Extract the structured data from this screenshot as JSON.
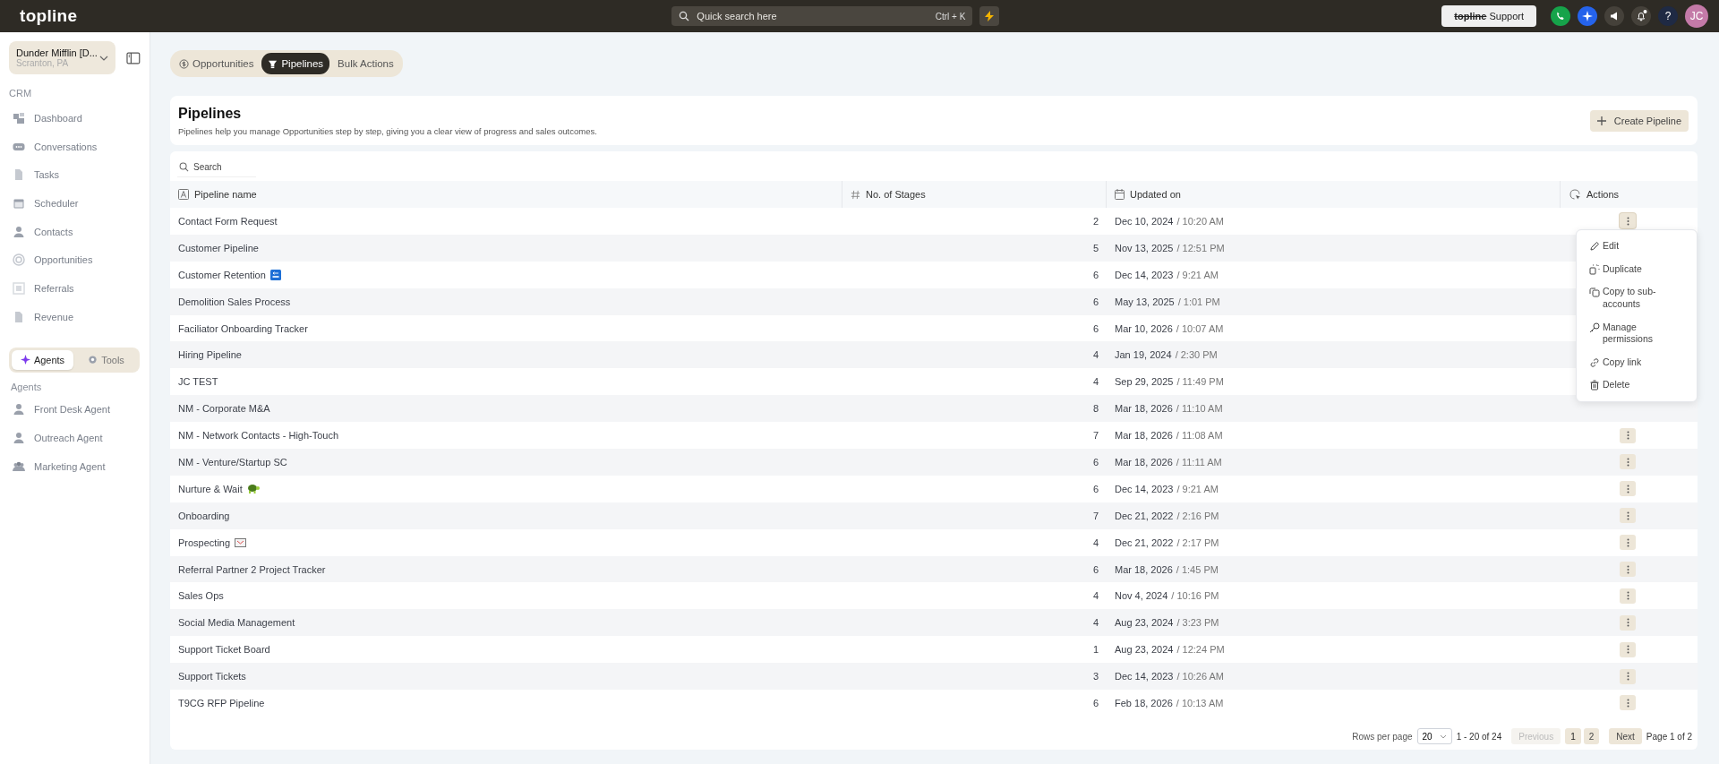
{
  "topbar": {
    "logo": "topline",
    "search": {
      "placeholder": "Quick search here",
      "shortcut": "Ctrl + K"
    },
    "support": {
      "brand": "topline",
      "label": "Support"
    },
    "avatar": "JC",
    "help": "?",
    "notification_dot": true
  },
  "sidebar": {
    "account": {
      "name": "Dunder Mifflin [D...",
      "location": "Scranton, PA"
    },
    "section": "CRM",
    "items": [
      {
        "label": "Dashboard"
      },
      {
        "label": "Conversations"
      },
      {
        "label": "Tasks"
      },
      {
        "label": "Scheduler"
      },
      {
        "label": "Contacts"
      },
      {
        "label": "Opportunities"
      },
      {
        "label": "Referrals"
      },
      {
        "label": "Revenue"
      }
    ],
    "switch": [
      {
        "label": "Agents",
        "selected": true
      },
      {
        "label": "Tools",
        "selected": false
      }
    ],
    "agents_heading": "Agents",
    "agents": [
      {
        "label": "Front Desk Agent"
      },
      {
        "label": "Outreach Agent"
      },
      {
        "label": "Marketing Agent"
      }
    ]
  },
  "tabs": [
    {
      "label": "Opportunities",
      "selected": false
    },
    {
      "label": "Pipelines",
      "selected": true
    },
    {
      "label": "Bulk Actions",
      "selected": false
    }
  ],
  "header": {
    "title": "Pipelines",
    "description": "Pipelines help you manage Opportunities step by step, giving you a clear view of progress and sales outcomes.",
    "button": "Create Pipeline"
  },
  "table": {
    "search_placeholder": "Search",
    "columns": [
      "Pipeline name",
      "No. of Stages",
      "Updated on",
      "Actions"
    ],
    "rows": [
      {
        "name": "Contact Form Request",
        "stages": "2",
        "date": "Dec 10, 2024",
        "time": "/ 10:20 AM",
        "actions_shown": true,
        "menu_open": true
      },
      {
        "name": "Customer Pipeline",
        "stages": "5",
        "date": "Nov 13, 2025",
        "time": "/ 12:51 PM",
        "actions_shown": false,
        "menu_open": false
      },
      {
        "name": "Customer Retention",
        "kind": "back",
        "stages": "6",
        "date": "Dec 14, 2023",
        "time": "/ 9:21 AM",
        "actions_shown": false,
        "menu_open": false
      },
      {
        "name": "Demolition Sales Process",
        "stages": "6",
        "date": "May 13, 2025",
        "time": "/ 1:01 PM",
        "actions_shown": false,
        "menu_open": false
      },
      {
        "name": "Faciliator Onboarding Tracker",
        "stages": "6",
        "date": "Mar 10, 2026",
        "time": "/ 10:07 AM",
        "actions_shown": false,
        "menu_open": false
      },
      {
        "name": "Hiring Pipeline",
        "stages": "4",
        "date": "Jan 19, 2024",
        "time": "/ 2:30 PM",
        "actions_shown": false,
        "menu_open": false
      },
      {
        "name": "JC TEST",
        "stages": "4",
        "date": "Sep 29, 2025",
        "time": "/ 11:49 PM",
        "actions_shown": false,
        "menu_open": false
      },
      {
        "name": "NM - Corporate M&A",
        "stages": "8",
        "date": "Mar 18, 2026",
        "time": "/ 11:10 AM",
        "actions_shown": false,
        "menu_open": false
      },
      {
        "name": "NM - Network Contacts - High-Touch",
        "stages": "7",
        "date": "Mar 18, 2026",
        "time": "/ 11:08 AM",
        "actions_shown": true,
        "menu_open": false
      },
      {
        "name": "NM - Venture/Startup SC",
        "stages": "6",
        "date": "Mar 18, 2026",
        "time": "/ 11:11 AM",
        "actions_shown": true,
        "menu_open": false
      },
      {
        "name": "Nurture & Wait",
        "kind": "turtle",
        "stages": "6",
        "date": "Dec 14, 2023",
        "time": "/ 9:21 AM",
        "actions_shown": true,
        "menu_open": false
      },
      {
        "name": "Onboarding",
        "stages": "7",
        "date": "Dec 21, 2022",
        "time": "/ 2:16 PM",
        "actions_shown": true,
        "menu_open": false
      },
      {
        "name": "Prospecting",
        "kind": "envelope",
        "stages": "4",
        "date": "Dec 21, 2022",
        "time": "/ 2:17 PM",
        "actions_shown": true,
        "menu_open": false
      },
      {
        "name": "Referral Partner 2 Project Tracker",
        "stages": "6",
        "date": "Mar 18, 2026",
        "time": "/ 1:45 PM",
        "actions_shown": true,
        "menu_open": false
      },
      {
        "name": "Sales Ops",
        "stages": "4",
        "date": "Nov 4, 2024",
        "time": "/ 10:16 PM",
        "actions_shown": true,
        "menu_open": false
      },
      {
        "name": "Social Media Management",
        "stages": "4",
        "date": "Aug 23, 2024",
        "time": "/ 3:23 PM",
        "actions_shown": true,
        "menu_open": false
      },
      {
        "name": "Support Ticket Board",
        "stages": "1",
        "date": "Aug 23, 2024",
        "time": "/ 12:24 PM",
        "actions_shown": true,
        "menu_open": false
      },
      {
        "name": "Support Tickets",
        "stages": "3",
        "date": "Dec 14, 2023",
        "time": "/ 10:26 AM",
        "actions_shown": true,
        "menu_open": false
      },
      {
        "name": "T9CG RFP Pipeline",
        "stages": "6",
        "date": "Feb 18, 2026",
        "time": "/ 10:13 AM",
        "actions_shown": true,
        "menu_open": false
      }
    ]
  },
  "menu": [
    "Edit",
    "Duplicate",
    "Copy to sub-accounts",
    "Manage permissions",
    "Copy link",
    "Delete"
  ],
  "pagination": {
    "rows_label": "Rows per page",
    "rows_value": "20",
    "range": "1 - 20 of 24",
    "previous": "Previous",
    "pages": [
      {
        "label": "1",
        "selected": true
      },
      {
        "label": "2",
        "selected": false
      }
    ],
    "next": "Next",
    "page_info": "Page 1 of 2",
    "previous_disabled": true
  }
}
